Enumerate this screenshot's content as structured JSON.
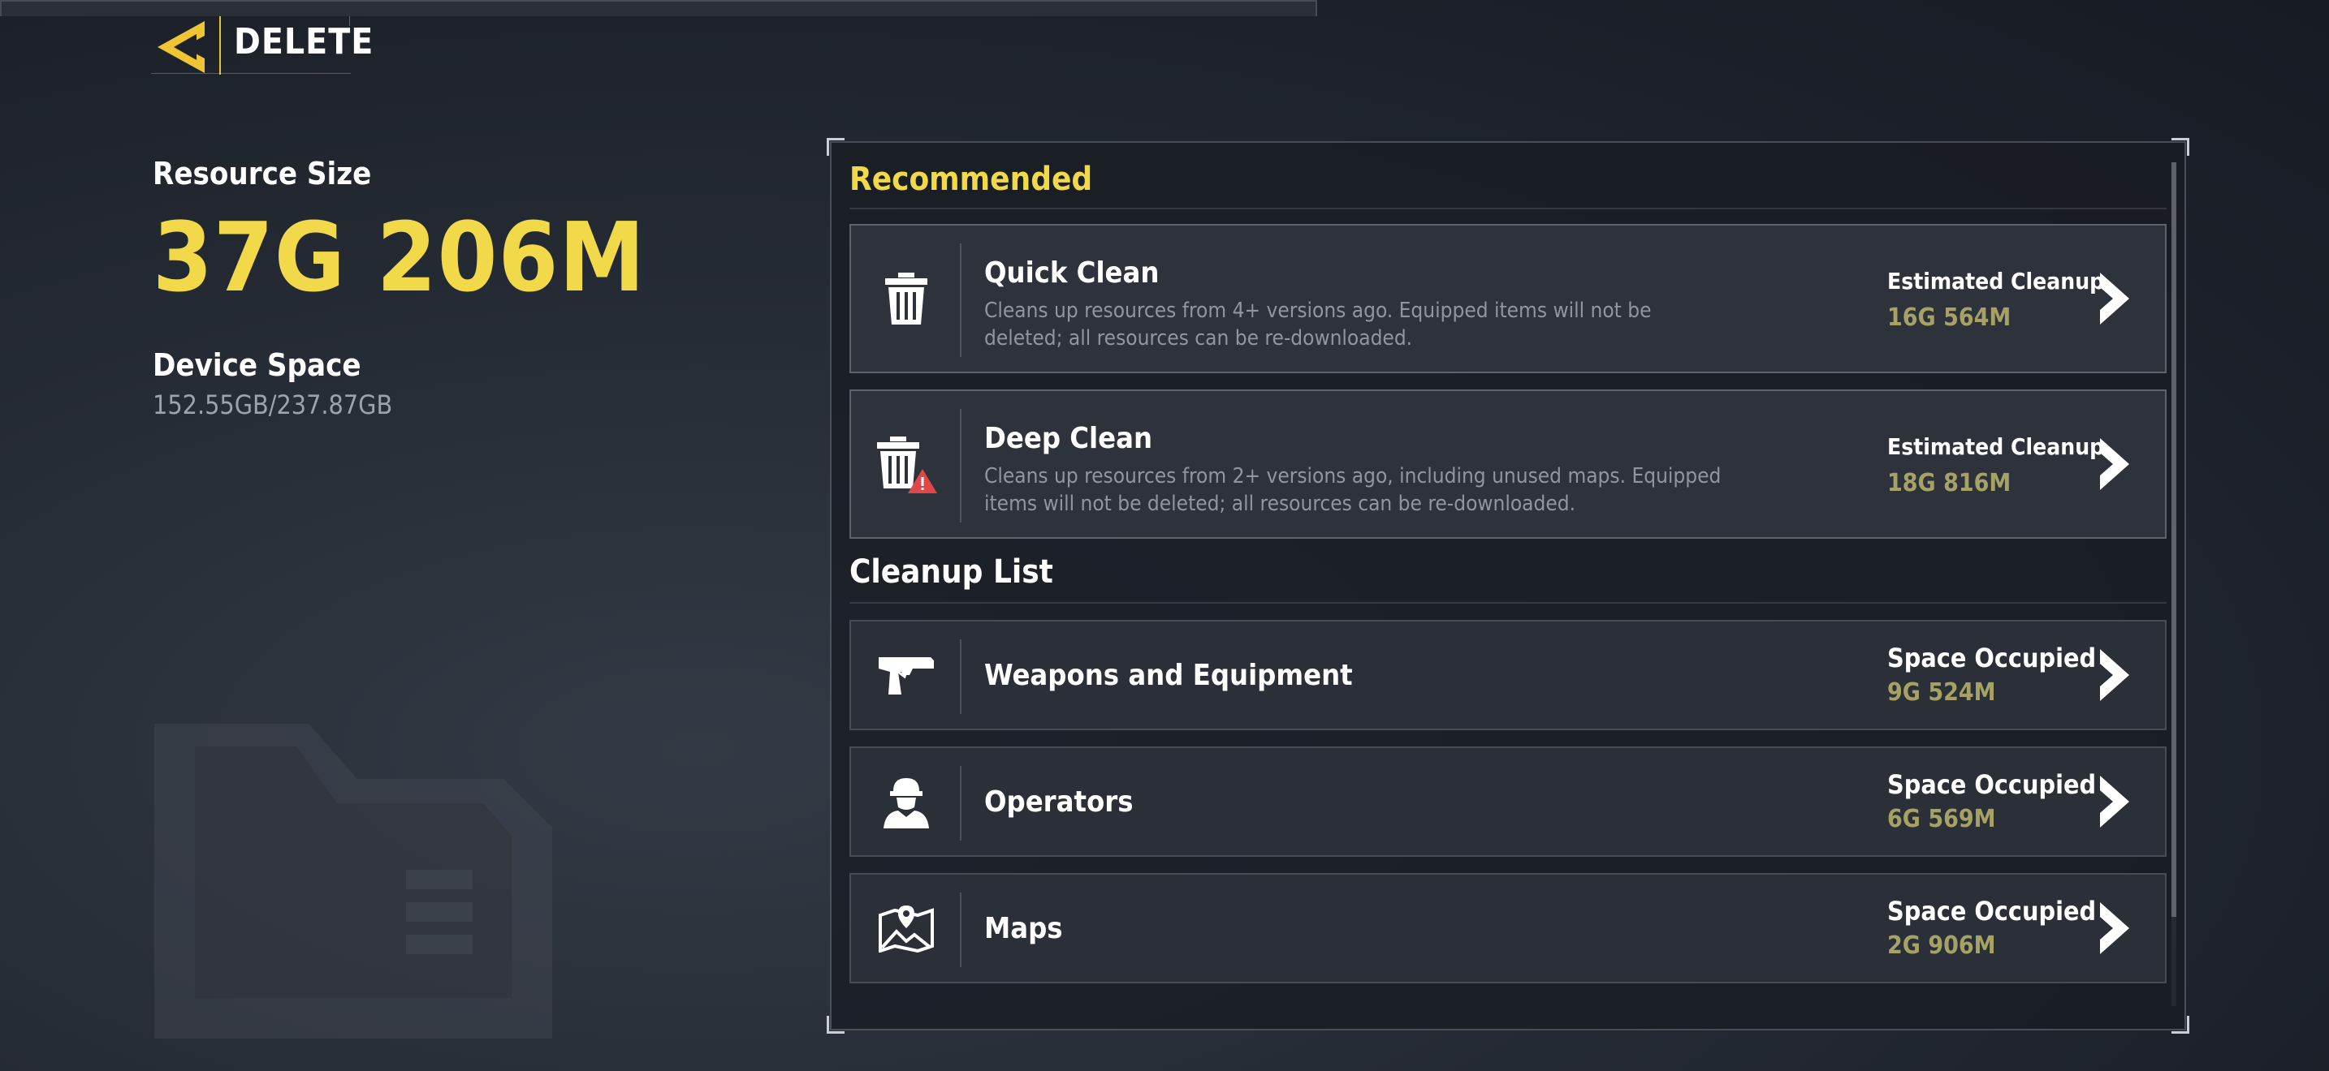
{
  "header": {
    "title": "DELETE",
    "back_icon": "back-chevron-icon",
    "accent_color": "#f2d94a"
  },
  "info": {
    "resource_size_label": "Resource Size",
    "resource_size_value": "37G 206M",
    "device_space_label": "Device Space",
    "device_space_value": "152.55GB/237.87GB"
  },
  "recommended": {
    "heading": "Recommended",
    "items": [
      {
        "title": "Quick Clean",
        "description": "Cleans up resources from 4+ versions ago. Equipped items will not be deleted; all resources can be re-downloaded.",
        "meta_label": "Estimated Cleanup",
        "meta_value": "16G 564M",
        "icon": "trash-icon"
      },
      {
        "title": "Deep Clean",
        "description": "Cleans up resources from 2+ versions ago, including unused maps. Equipped items will not be deleted; all resources can be re-downloaded.",
        "meta_label": "Estimated Cleanup",
        "meta_value": "18G 816M",
        "icon": "trash-warning-icon"
      }
    ]
  },
  "cleanup_list": {
    "heading": "Cleanup List",
    "items": [
      {
        "title": "Weapons and Equipment",
        "meta_label": "Space Occupied",
        "meta_value": "9G 524M",
        "icon": "pistol-icon"
      },
      {
        "title": "Operators",
        "meta_label": "Space Occupied",
        "meta_value": "6G 569M",
        "icon": "operator-icon"
      },
      {
        "title": "Maps",
        "meta_label": "Space Occupied",
        "meta_value": "2G 906M",
        "icon": "map-icon"
      }
    ]
  },
  "colors": {
    "value_gold": "#a6a266",
    "heading_yellow": "#f2d94a"
  }
}
